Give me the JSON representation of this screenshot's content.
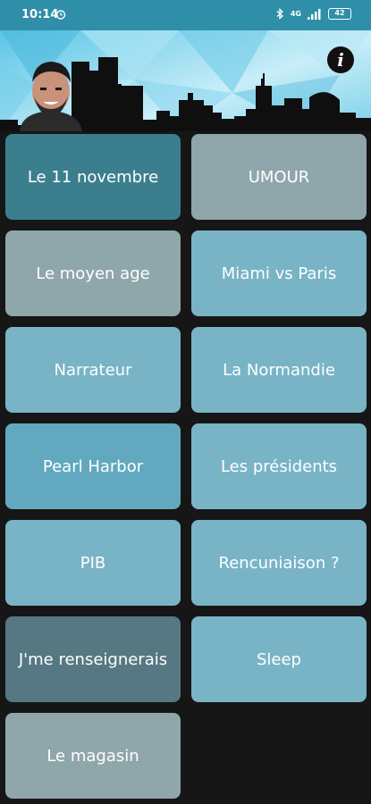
{
  "status_bar": {
    "time": "10:14",
    "signal_text": "4G",
    "battery": "42"
  },
  "header": {
    "info_label": "i"
  },
  "tiles": [
    {
      "label": "Le 11 novembre",
      "color": "#3b7f8e"
    },
    {
      "label": "UMOUR",
      "color": "#8fa6aa"
    },
    {
      "label": "Le moyen age",
      "color": "#8fa6aa"
    },
    {
      "label": "Miami vs Paris",
      "color": "#78b4c6"
    },
    {
      "label": "Narrateur",
      "color": "#78b4c6"
    },
    {
      "label": "La Normandie",
      "color": "#78b4c6"
    },
    {
      "label": "Pearl Harbor",
      "color": "#62a9bf"
    },
    {
      "label": "Les présidents",
      "color": "#78b4c6"
    },
    {
      "label": "PIB",
      "color": "#78b4c6"
    },
    {
      "label": "Rencuniaison ?",
      "color": "#78b4c6"
    },
    {
      "label": "J'me renseignerais",
      "color": "#557883"
    },
    {
      "label": "Sleep",
      "color": "#78b4c6"
    },
    {
      "label": "Le magasin",
      "color": "#8fa6aa"
    }
  ]
}
